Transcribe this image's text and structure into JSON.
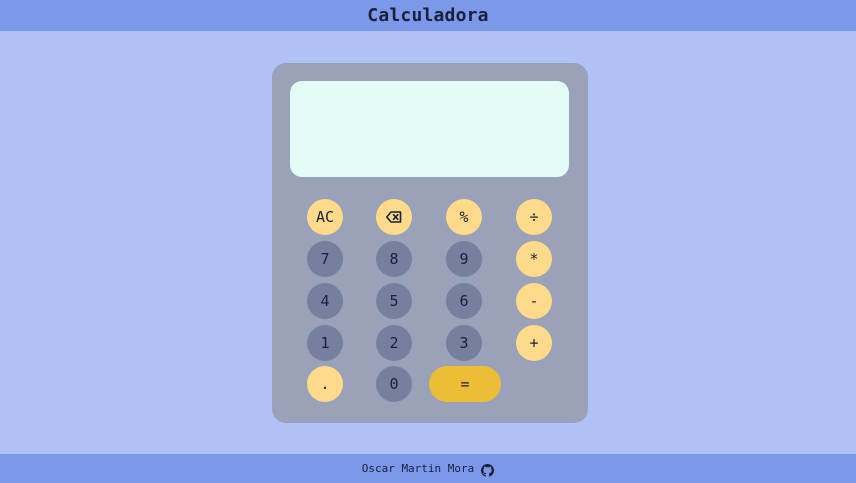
{
  "header": {
    "title": "Calculadora"
  },
  "calculator": {
    "display_value": "",
    "buttons": {
      "clear": "AC",
      "backspace_icon": "backspace-icon",
      "percent": "%",
      "divide": "÷",
      "seven": "7",
      "eight": "8",
      "nine": "9",
      "multiply": "*",
      "four": "4",
      "five": "5",
      "six": "6",
      "subtract": "-",
      "one": "1",
      "two": "2",
      "three": "3",
      "add": "+",
      "decimal": ".",
      "zero": "0",
      "equals": "="
    }
  },
  "footer": {
    "author": "Oscar Martin Mora",
    "icon": "github-icon"
  },
  "colors": {
    "page_background": "#b0c1f5",
    "bars": "#7b98e9",
    "calculator_body": "#99a2b8",
    "display": "#e3fcf8",
    "operator_button": "#ffda8a",
    "number_button": "#76809e",
    "equals_button": "#eebd36",
    "text": "#1a1f3c"
  }
}
